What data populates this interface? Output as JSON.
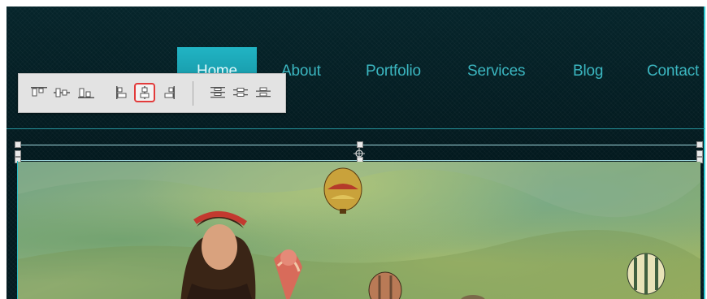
{
  "nav": {
    "items": [
      "Home",
      "About",
      "Portfolio",
      "Services",
      "Blog",
      "Contact"
    ],
    "active": "Home"
  },
  "toolbar": {
    "buttons": [
      "align-top-icon",
      "align-vertical-center-icon",
      "align-bottom-icon",
      "align-left-icon",
      "align-horizontal-center-icon",
      "align-right-icon",
      "distribute-top-icon",
      "distribute-center-icon",
      "distribute-bottom-icon"
    ],
    "selected": "align-horizontal-center-icon"
  },
  "colors": {
    "accent": "#21b4c4",
    "nav_text": "#3bb6c0",
    "selection_outline": "#e23b3b"
  }
}
